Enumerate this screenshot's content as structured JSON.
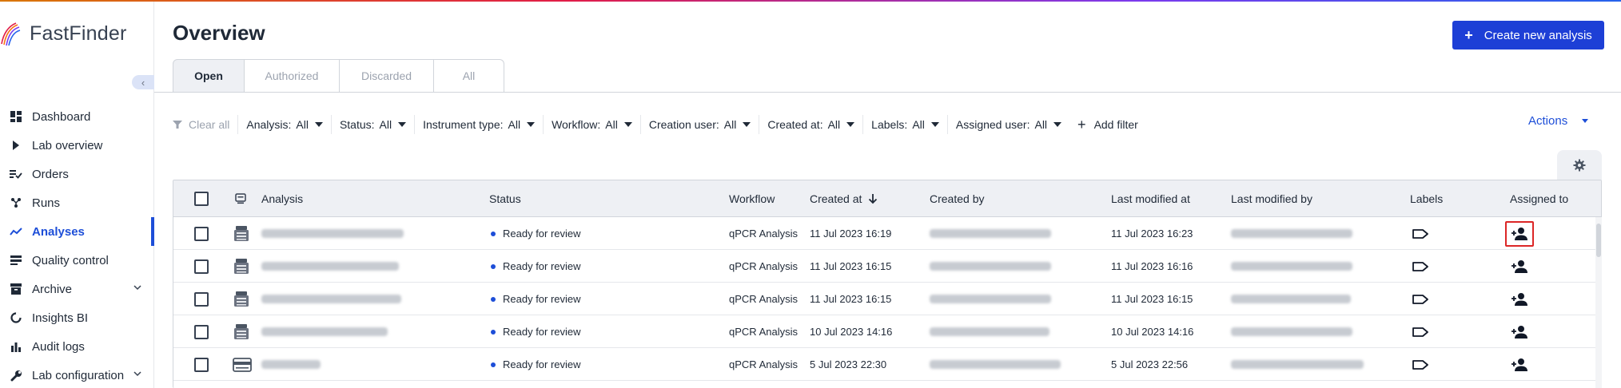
{
  "app": {
    "name": "FastFinder"
  },
  "sidebar": {
    "collapse_glyph": "‹",
    "items": [
      {
        "label": "Dashboard",
        "icon": "dashboard-icon"
      },
      {
        "label": "Lab overview",
        "icon": "play-icon"
      },
      {
        "label": "Orders",
        "icon": "orders-icon"
      },
      {
        "label": "Runs",
        "icon": "runs-icon"
      },
      {
        "label": "Analyses",
        "icon": "analyses-icon",
        "active": true
      },
      {
        "label": "Quality control",
        "icon": "quality-control-icon"
      },
      {
        "label": "Archive",
        "icon": "archive-icon",
        "expandable": true
      },
      {
        "label": "Insights BI",
        "icon": "insights-icon"
      },
      {
        "label": "Audit logs",
        "icon": "audit-logs-icon"
      },
      {
        "label": "Lab configuration",
        "icon": "wrench-icon",
        "expandable": true
      }
    ]
  },
  "header": {
    "title": "Overview",
    "create_button": "Create new analysis",
    "create_button_glyph": "+"
  },
  "tabs": [
    {
      "label": "Open",
      "active": true
    },
    {
      "label": "Authorized"
    },
    {
      "label": "Discarded"
    },
    {
      "label": "All"
    }
  ],
  "filters": {
    "clear_all": "Clear all",
    "items": [
      {
        "label": "Analysis:",
        "value": "All"
      },
      {
        "label": "Status:",
        "value": "All"
      },
      {
        "label": "Instrument type:",
        "value": "All"
      },
      {
        "label": "Workflow:",
        "value": "All"
      },
      {
        "label": "Creation user:",
        "value": "All"
      },
      {
        "label": "Created at:",
        "value": "All"
      },
      {
        "label": "Labels:",
        "value": "All"
      },
      {
        "label": "Assigned user:",
        "value": "All"
      }
    ],
    "add_filter": "Add filter",
    "add_filter_glyph": "+"
  },
  "actions": {
    "label": "Actions"
  },
  "table": {
    "columns": {
      "analysis": "Analysis",
      "status": "Status",
      "workflow": "Workflow",
      "created_at": "Created at",
      "created_by": "Created by",
      "last_modified_at": "Last modified at",
      "last_modified_by": "Last modified by",
      "labels": "Labels",
      "assigned_to": "Assigned to"
    },
    "sort_column": "created_at",
    "sort_direction": "descending",
    "rows": [
      {
        "status": "Ready for review",
        "workflow": "qPCR Analysis",
        "created_at": "11 Jul 2023 16:19",
        "last_modified_at": "11 Jul 2023 16:23",
        "icon": "instrument-icon",
        "highlight_assign": true
      },
      {
        "status": "Ready for review",
        "workflow": "qPCR Analysis",
        "created_at": "11 Jul 2023 16:15",
        "last_modified_at": "11 Jul 2023 16:16",
        "icon": "instrument-icon"
      },
      {
        "status": "Ready for review",
        "workflow": "qPCR Analysis",
        "created_at": "11 Jul 2023 16:15",
        "last_modified_at": "11 Jul 2023 16:15",
        "icon": "instrument-icon"
      },
      {
        "status": "Ready for review",
        "workflow": "qPCR Analysis",
        "created_at": "10 Jul 2023 14:16",
        "last_modified_at": "10 Jul 2023 14:16",
        "icon": "instrument-icon"
      },
      {
        "status": "Ready for review",
        "workflow": "qPCR Analysis",
        "created_at": "5 Jul 2023 22:30",
        "last_modified_at": "5 Jul 2023 22:56",
        "icon": "plate-icon"
      }
    ]
  },
  "colors": {
    "accent": "#1d3fd6",
    "active_nav": "#1d4ed8",
    "header_bg": "#eef0f4",
    "highlight": "#dc2626"
  }
}
